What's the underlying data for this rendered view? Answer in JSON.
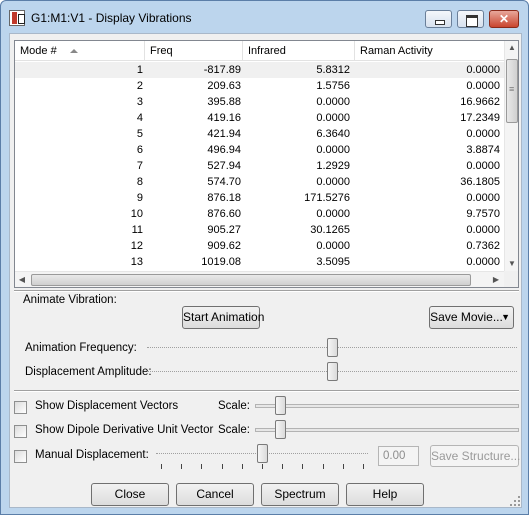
{
  "window": {
    "title": "G1:M1:V1 - Display Vibrations"
  },
  "table": {
    "columns": [
      "Mode #",
      "Freq",
      "Infrared",
      "Raman Activity"
    ],
    "rows": [
      [
        "1",
        "-817.89",
        "5.8312",
        "0.0000"
      ],
      [
        "2",
        "209.63",
        "1.5756",
        "0.0000"
      ],
      [
        "3",
        "395.88",
        "0.0000",
        "16.9662"
      ],
      [
        "4",
        "419.16",
        "0.0000",
        "17.2349"
      ],
      [
        "5",
        "421.94",
        "6.3640",
        "0.0000"
      ],
      [
        "6",
        "496.94",
        "0.0000",
        "3.8874"
      ],
      [
        "7",
        "527.94",
        "1.2929",
        "0.0000"
      ],
      [
        "8",
        "574.70",
        "0.0000",
        "36.1805"
      ],
      [
        "9",
        "876.18",
        "171.5276",
        "0.0000"
      ],
      [
        "10",
        "876.60",
        "0.0000",
        "9.7570"
      ],
      [
        "11",
        "905.27",
        "30.1265",
        "0.0000"
      ],
      [
        "12",
        "909.62",
        "0.0000",
        "0.7362"
      ],
      [
        "13",
        "1019.08",
        "3.5095",
        "0.0000"
      ]
    ],
    "selected_row": 0
  },
  "animate": {
    "section_label": "Animate Vibration:",
    "start_label": "Start Animation",
    "save_movie_label": "Save Movie...",
    "frequency_label": "Animation Frequency:",
    "frequency_level": 0.5,
    "amplitude_label": "Displacement Amplitude:",
    "amplitude_level": 0.5
  },
  "options": {
    "show_vectors_label": "Show Displacement Vectors",
    "show_vectors_checked": false,
    "vectors_scale_label": "Scale:",
    "vectors_scale_level": 0.08,
    "show_dipole_label": "Show Dipole Derivative Unit Vector",
    "show_dipole_checked": false,
    "dipole_scale_label": "Scale:",
    "dipole_scale_level": 0.08,
    "manual_label": "Manual Displacement:",
    "manual_checked": false,
    "manual_level": 0.5,
    "manual_value": "0.00",
    "save_structure_label": "Save Structure..."
  },
  "footer": {
    "close_label": "Close",
    "cancel_label": "Cancel",
    "spectrum_label": "Spectrum",
    "help_label": "Help"
  }
}
